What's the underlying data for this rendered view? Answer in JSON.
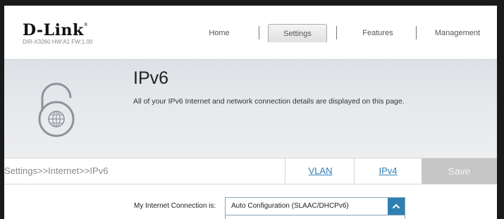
{
  "brand": {
    "logo_text": "D-Link",
    "model_info": "DIR-X3260 HW:A1 FW:1.00"
  },
  "nav": {
    "items": [
      {
        "label": "Home"
      },
      {
        "label": "Settings",
        "active": true
      },
      {
        "label": "Features"
      },
      {
        "label": "Management"
      }
    ]
  },
  "banner": {
    "title": "IPv6",
    "description": "All of your IPv6 Internet and network connection details are displayed on this page.",
    "icon": "ipv6-lock-globe-icon"
  },
  "breadcrumb": {
    "path": "Settings>>Internet>>IPv6",
    "links": [
      {
        "label": "VLAN"
      },
      {
        "label": "IPv4"
      }
    ],
    "save_label": "Save"
  },
  "form": {
    "connection_label": "My Internet Connection is:",
    "connection_value": "Auto Configuration (SLAAC/DHCPv6)"
  },
  "colors": {
    "accent": "#2f7fb3",
    "save_disabled": "#c6c6c6",
    "banner_bg": "#e3e6e9"
  }
}
